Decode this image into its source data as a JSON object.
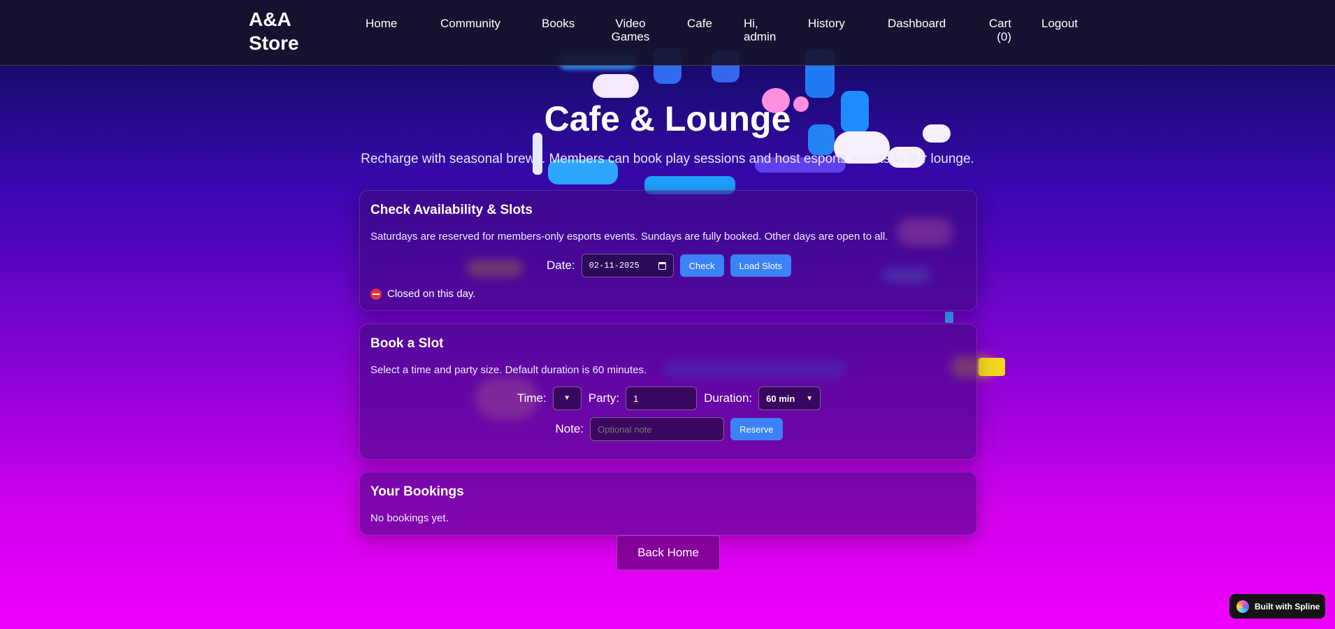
{
  "nav": {
    "brand": "A&A Store",
    "links": {
      "home": "Home",
      "community": "Community",
      "books": "Books",
      "video_games": "Video Games",
      "cafe": "Cafe",
      "greeting": "Hi, admin",
      "history": "History",
      "dashboard": "Dashboard",
      "cart": "Cart (0)",
      "logout": "Logout"
    }
  },
  "hero": {
    "title": "Cafe & Lounge",
    "subtitle": "Recharge with seasonal brews. Members can book play sessions and host esports events in our lounge."
  },
  "availability": {
    "title": "Check Availability & Slots",
    "description": "Saturdays are reserved for members-only esports events. Sundays are fully booked. Other days are open to all.",
    "date_label": "Date:",
    "date_value": "02-11-2025",
    "check_label": "Check",
    "load_slots_label": "Load Slots",
    "status": "Closed on this day."
  },
  "booking": {
    "title": "Book a Slot",
    "description": "Select a time and party size. Default duration is 60 minutes.",
    "time_label": "Time:",
    "time_value": "",
    "party_label": "Party:",
    "party_value": "1",
    "duration_label": "Duration:",
    "duration_value": "60 min",
    "note_label": "Note:",
    "note_placeholder": "Optional note",
    "reserve_label": "Reserve"
  },
  "bookings": {
    "title": "Your Bookings",
    "empty": "No bookings yet."
  },
  "back_home": "Back Home",
  "spline_badge": "Built with Spline",
  "colors": {
    "accent": "#3b82f6",
    "danger": "#e3313e"
  }
}
